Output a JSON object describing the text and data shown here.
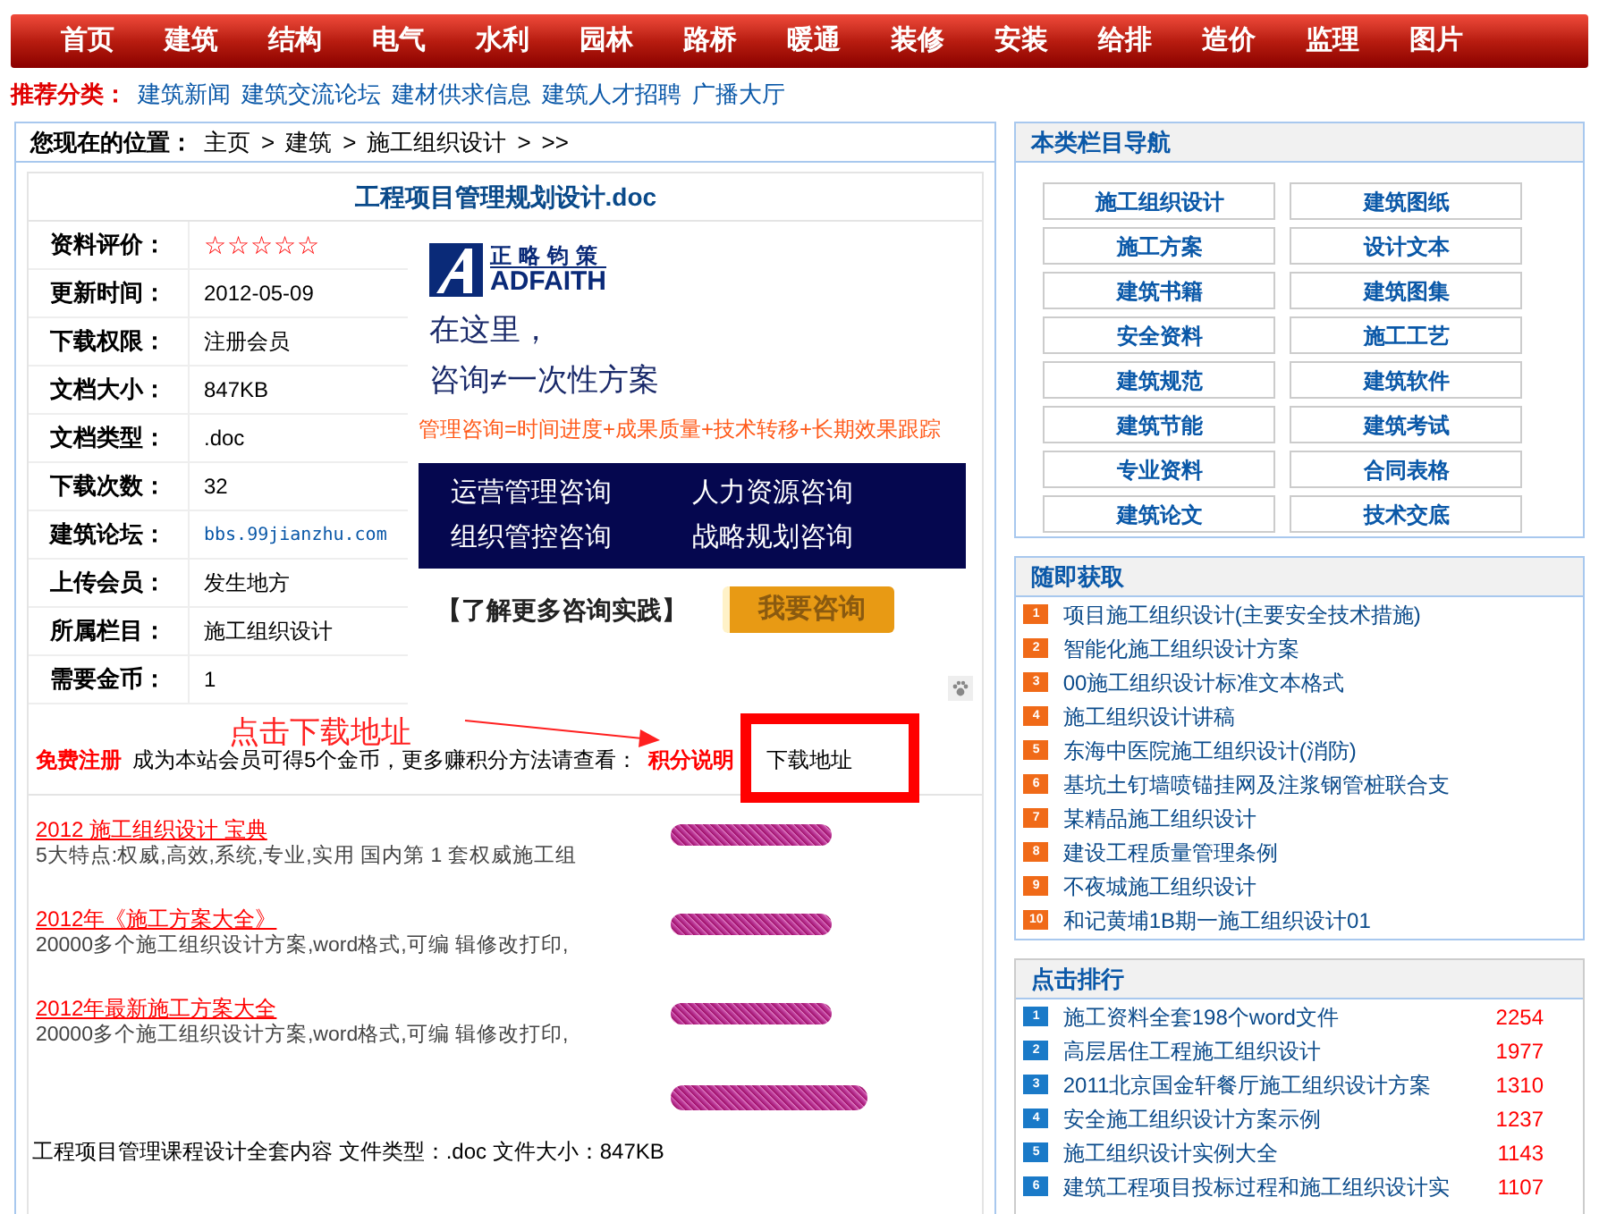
{
  "nav": [
    {
      "label": "首页"
    },
    {
      "label": "建筑"
    },
    {
      "label": "结构"
    },
    {
      "label": "电气"
    },
    {
      "label": "水利"
    },
    {
      "label": "园林"
    },
    {
      "label": "路桥"
    },
    {
      "label": "暖通"
    },
    {
      "label": "装修"
    },
    {
      "label": "安装"
    },
    {
      "label": "给排"
    },
    {
      "label": "造价"
    },
    {
      "label": "监理"
    },
    {
      "label": "图片"
    }
  ],
  "recommend": {
    "label": "推荐分类：",
    "links": [
      "建筑新闻",
      "建筑交流论坛",
      "建材供求信息",
      "建筑人才招聘",
      "广播大厅"
    ]
  },
  "breadcrumb": {
    "label": "您现在的位置：",
    "items": [
      "主页",
      "建筑",
      "施工组织设计",
      ">>"
    ],
    "separator": ">"
  },
  "document": {
    "title": "工程项目管理规划设计.doc",
    "info": [
      {
        "label": "资料评价：",
        "value": "☆☆☆☆☆",
        "kind": "stars"
      },
      {
        "label": "更新时间：",
        "value": "2012-05-09",
        "kind": "text"
      },
      {
        "label": "下载权限：",
        "value": "注册会员",
        "kind": "text"
      },
      {
        "label": "文档大小：",
        "value": "847KB",
        "kind": "text"
      },
      {
        "label": "文档类型：",
        "value": ".doc",
        "kind": "text"
      },
      {
        "label": "下载次数：",
        "value": "32",
        "kind": "text"
      },
      {
        "label": "建筑论坛：",
        "value": "bbs.99jianzhu.com",
        "kind": "link"
      },
      {
        "label": "上传会员：",
        "value": "发生地方",
        "kind": "text"
      },
      {
        "label": "所属栏目：",
        "value": "施工组织设计",
        "kind": "text"
      },
      {
        "label": "需要金币：",
        "value": "1",
        "kind": "text"
      }
    ],
    "ad": {
      "brand_cn": "正略钧策",
      "brand_en": "ADFAITH",
      "headline_1": "在这里，",
      "headline_2": "咨询≠一次性方案",
      "formula": "管理咨询=时间进度+成果质量+技术转移+长期效果跟踪",
      "services": [
        "运营管理咨询",
        "人力资源咨询",
        "组织管控咨询",
        "战略规划咨询"
      ],
      "more": "【了解更多咨询实践】",
      "button": "我要咨询"
    },
    "annotation": "点击下载地址",
    "register": {
      "link": "免费注册",
      "text": "成为本站会员可得5个金币，更多赚积分方法请查看：",
      "points_link": "积分说明",
      "download": "下载地址"
    },
    "promos": [
      {
        "title": "2012 施工组织设计 宝典",
        "desc": "5大特点:权威,高效,系统,专业,实用 国内第 1 套权威施工组"
      },
      {
        "title": "2012年《施工方案大全》",
        "desc": "20000多个施工组织设计方案,word格式,可编 辑修改打印,"
      },
      {
        "title": "2012年最新施工方案大全",
        "desc": "20000多个施工组织设计方案,word格式,可编 辑修改打印,"
      }
    ],
    "summary": "工程项目管理课程设计全套内容 文件类型：.doc 文件大小：847KB"
  },
  "category_nav": {
    "title": "本类栏目导航",
    "items": [
      "施工组织设计",
      "建筑图纸",
      "施工方案",
      "设计文本",
      "建筑书籍",
      "建筑图集",
      "安全资料",
      "施工工艺",
      "建筑规范",
      "建筑软件",
      "建筑节能",
      "建筑考试",
      "专业资料",
      "合同表格",
      "建筑论文",
      "技术交底"
    ]
  },
  "random": {
    "title": "随即获取",
    "items": [
      {
        "rank": "1",
        "label": "项目施工组织设计(主要安全技术措施)"
      },
      {
        "rank": "2",
        "label": "智能化施工组织设计方案"
      },
      {
        "rank": "3",
        "label": "00施工组织设计标准文本格式"
      },
      {
        "rank": "4",
        "label": "施工组织设计讲稿"
      },
      {
        "rank": "5",
        "label": "东海中医院施工组织设计(消防)"
      },
      {
        "rank": "6",
        "label": "基坑土钉墙喷锚挂网及注浆钢管桩联合支"
      },
      {
        "rank": "7",
        "label": "某精品施工组织设计"
      },
      {
        "rank": "8",
        "label": "建设工程质量管理条例"
      },
      {
        "rank": "9",
        "label": "不夜城施工组织设计"
      },
      {
        "rank": "10",
        "label": "和记黄埔1B期一施工组织设计01"
      }
    ]
  },
  "ranking": {
    "title": "点击排行",
    "items": [
      {
        "rank": "1",
        "label": "施工资料全套198个word文件",
        "count": "2254"
      },
      {
        "rank": "2",
        "label": "高层居住工程施工组织设计",
        "count": "1977"
      },
      {
        "rank": "3",
        "label": "2011北京国金轩餐厅施工组织设计方案",
        "count": "1310"
      },
      {
        "rank": "4",
        "label": "安全施工组织设计方案示例",
        "count": "1237"
      },
      {
        "rank": "5",
        "label": "施工组织设计实例大全",
        "count": "1143"
      },
      {
        "rank": "6",
        "label": "建筑工程项目投标过程和施工组织设计实",
        "count": "1107"
      }
    ]
  }
}
